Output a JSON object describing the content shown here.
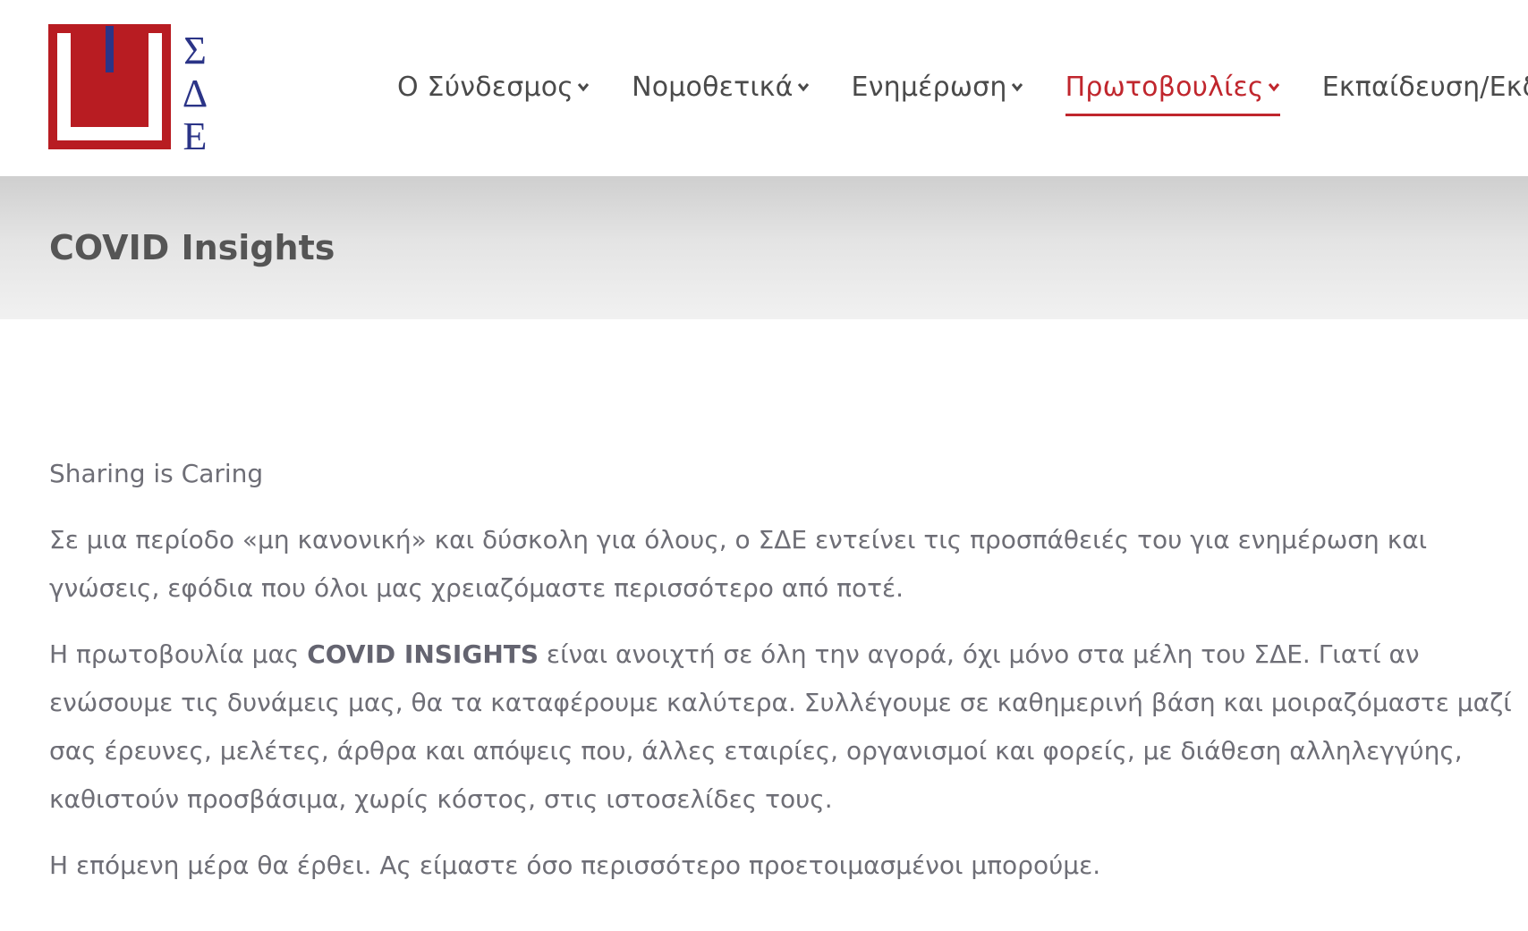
{
  "logo": {
    "letters": [
      "Σ",
      "Δ",
      "Ε"
    ],
    "colors": {
      "red": "#b81c22",
      "blue": "#2b3487"
    }
  },
  "nav": {
    "items": [
      {
        "label": "Ο Σύνδεσμος",
        "active": false
      },
      {
        "label": "Νομοθετικά",
        "active": false
      },
      {
        "label": "Ενημέρωση",
        "active": false
      },
      {
        "label": "Πρωτοβουλίες",
        "active": true
      },
      {
        "label": "Εκπαίδευση/Εκδηλ",
        "active": false
      }
    ],
    "active_color": "#c0262d",
    "icon": "chevron-down-icon"
  },
  "page": {
    "title": "COVID Insights"
  },
  "content": {
    "tagline": "Sharing is Caring",
    "paragraph1": "Σε μια περίοδο «μη κανονική» και δύσκολη για όλους, ο ΣΔΕ εντείνει τις προσπάθειές του για ενημέρωση και γνώσεις, εφόδια που όλοι μας χρειαζόμαστε περισσότερο από ποτέ.",
    "paragraph2_before": "Η πρωτοβουλία μας ",
    "paragraph2_bold": "COVID INSIGHTS",
    "paragraph2_after": " είναι ανοιχτή σε όλη την αγορά, όχι μόνο στα μέλη του ΣΔΕ. Γιατί αν ενώσουμε τις δυνάμεις μας, θα τα καταφέρουμε καλύτερα. Συλλέγουμε σε καθημερινή βάση και μοιραζόμαστε μαζί σας έρευνες, μελέτες, άρθρα και απόψεις που, άλλες εταιρίες, οργανισμοί και φορείς, με διάθεση αλληλεγγύης, καθιστούν προσβάσιμα, χωρίς κόστος, στις ιστοσελίδες τους.",
    "paragraph3": "Η επόμενη μέρα θα έρθει. Ας είμαστε όσο περισσότερο προετοιμασμένοι μπορούμε."
  }
}
